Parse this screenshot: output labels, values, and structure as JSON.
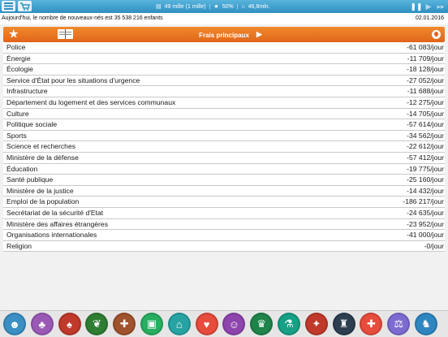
{
  "topbar": {
    "stats": {
      "population": "49 mille (1 mille)",
      "rating": "50%",
      "budget": "46,8mln."
    },
    "icons": [
      "menu-icon",
      "cart-icon",
      "population-icon",
      "rating-icon",
      "budget-icon",
      "pause-icon",
      "play-icon",
      "fast-forward-icon"
    ]
  },
  "news": {
    "message": "Aujourd'hui, le nombre de nouveaux-nés est 35 538 216 enfants",
    "date": "02.01.2016"
  },
  "panel": {
    "title": "Frais principaux",
    "colors": {
      "header": "#e8732a",
      "topbar": "#3a9ccf"
    }
  },
  "expenses": [
    {
      "name": "Police",
      "value": "-61 083/jour"
    },
    {
      "name": "Énergie",
      "value": "-11 709/jour"
    },
    {
      "name": "Écologie",
      "value": "-18 128/jour"
    },
    {
      "name": "Service d'État pour les situations d'urgence",
      "value": "-27 052/jour"
    },
    {
      "name": "Infrastructure",
      "value": "-11 688/jour"
    },
    {
      "name": "Département du logement et des services communaux",
      "value": "-12 275/jour"
    },
    {
      "name": "Culture",
      "value": "-14 705/jour"
    },
    {
      "name": "Politique sociale",
      "value": "-57 614/jour"
    },
    {
      "name": "Sports",
      "value": "-34 562/jour"
    },
    {
      "name": "Science et recherches",
      "value": "-22 612/jour"
    },
    {
      "name": "Ministère de la défense",
      "value": "-57 412/jour"
    },
    {
      "name": "Éducation",
      "value": "-19 775/jour"
    },
    {
      "name": "Santé publique",
      "value": "-25 160/jour"
    },
    {
      "name": "Ministère de la justice",
      "value": "-14 432/jour"
    },
    {
      "name": "Emploi de la population",
      "value": "-186 217/jour"
    },
    {
      "name": "Secrétariat de la sécurité d'Etat",
      "value": "-24 635/jour"
    },
    {
      "name": "Ministère des affaires étrangères",
      "value": "-23 952/jour"
    },
    {
      "name": "Organisations internationales",
      "value": "-41 000/jour"
    },
    {
      "name": "Religion",
      "value": "-0/jour"
    }
  ],
  "bottom_bar": [
    {
      "icon": "security-agents-icon",
      "color": "#3a8fc4"
    },
    {
      "icon": "theater-icon",
      "color": "#9b59b6"
    },
    {
      "icon": "fire-hydrant-icon",
      "color": "#c0392b"
    },
    {
      "icon": "ecology-leaf-icon",
      "color": "#2e7d32"
    },
    {
      "icon": "emergency-icon",
      "color": "#a0522d"
    },
    {
      "icon": "infrastructure-icon",
      "color": "#27ae60"
    },
    {
      "icon": "housing-icon",
      "color": "#27a3a3"
    },
    {
      "icon": "culture-icon",
      "color": "#e74c3c"
    },
    {
      "icon": "social-policy-icon",
      "color": "#8e44ad"
    },
    {
      "icon": "sports-trophy-icon",
      "color": "#1e8449"
    },
    {
      "icon": "science-flask-icon",
      "color": "#16a085"
    },
    {
      "icon": "defense-tank-icon",
      "color": "#c0392b"
    },
    {
      "icon": "education-graduate-icon",
      "color": "#2c3e50"
    },
    {
      "icon": "health-icon",
      "color": "#e74c3c"
    },
    {
      "icon": "justice-gavel-icon",
      "color": "#7d6bd1"
    },
    {
      "icon": "employment-worker-icon",
      "color": "#2e86c1"
    }
  ]
}
